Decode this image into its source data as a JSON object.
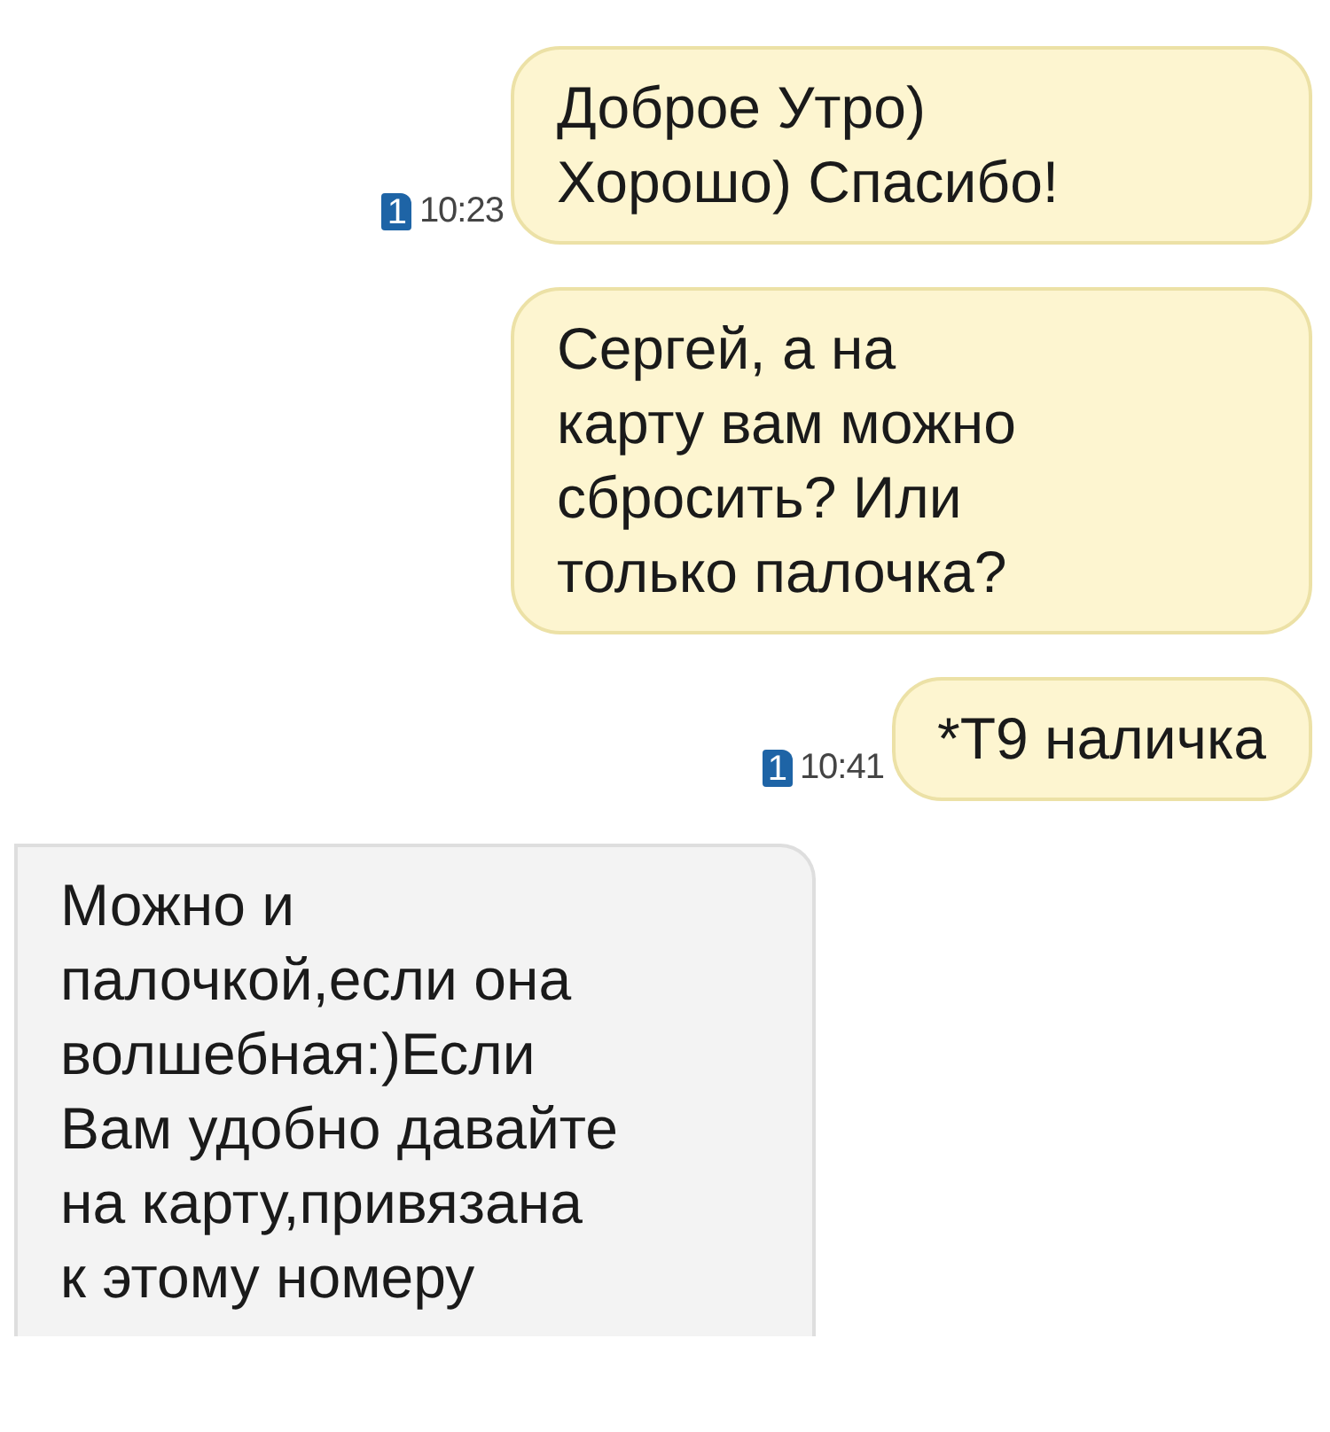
{
  "messages": [
    {
      "kind": "outgoing",
      "lines": [
        "Доброе Утро)",
        "Хорошо) Спасибо!"
      ],
      "sim": "1",
      "time": "10:23"
    },
    {
      "kind": "outgoing",
      "lines": [
        "Сергей, а на",
        "карту вам можно",
        "сбросить? Или",
        "только палочка?"
      ]
    },
    {
      "kind": "outgoing",
      "lines": [
        "*Т9 наличка"
      ],
      "sim": "1",
      "time": "10:41"
    },
    {
      "kind": "incoming",
      "lines": [
        "Можно и",
        "палочкой,если она",
        "волшебная:)Если",
        "Вам удобно давайте",
        "на карту,привязана",
        "к этому номеру"
      ]
    }
  ]
}
